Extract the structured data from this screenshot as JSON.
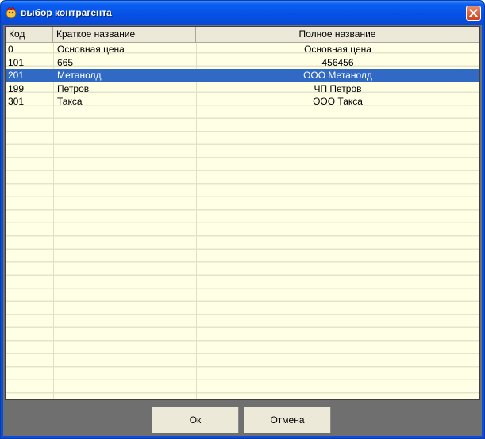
{
  "window": {
    "title": "выбор контрагента"
  },
  "grid": {
    "columns": [
      {
        "label": "Код"
      },
      {
        "label": "Краткое название"
      },
      {
        "label": "Полное название"
      }
    ],
    "rows": [
      {
        "code": "0",
        "short": "Основная цена",
        "full": "Основная цена",
        "selected": false
      },
      {
        "code": "101",
        "short": "665",
        "full": "456456",
        "selected": false
      },
      {
        "code": "201",
        "short": "Метанолд",
        "full": "ООО Метанолд",
        "selected": true
      },
      {
        "code": "199",
        "short": "Петров",
        "full": "ЧП Петров",
        "selected": false
      },
      {
        "code": "301",
        "short": "Такса",
        "full": "ООО Такса",
        "selected": false
      }
    ]
  },
  "buttons": {
    "ok": "Ок",
    "cancel": "Отмена"
  },
  "colors": {
    "selection": "#316ac5",
    "grid_bg": "#ffffe6",
    "titlebar": "#0551e6"
  }
}
